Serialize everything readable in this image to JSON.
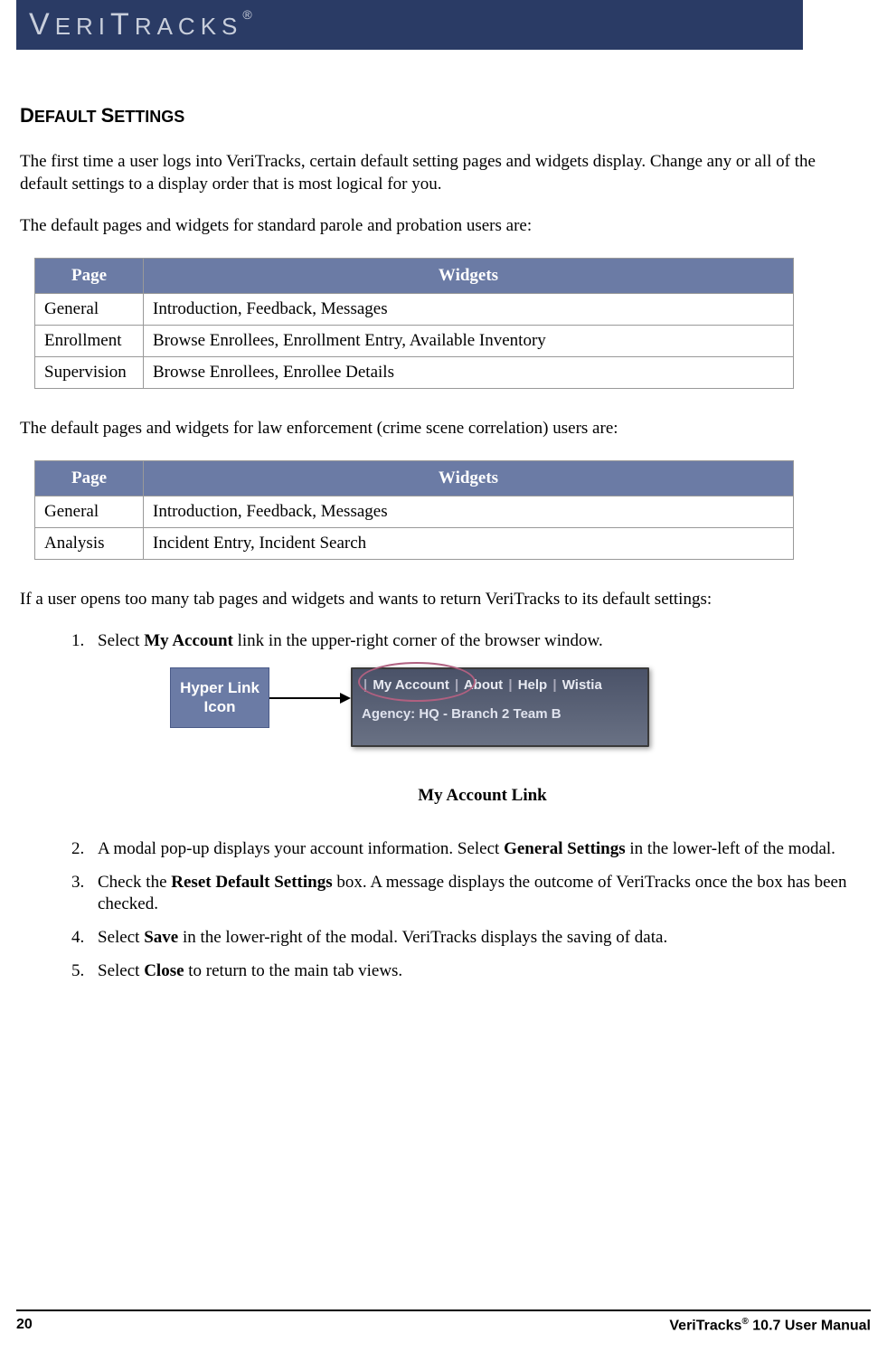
{
  "header": {
    "brand": "VERITRACKS",
    "reg": "®"
  },
  "title": {
    "big1": "D",
    "rest1": "EFAULT ",
    "big2": "S",
    "rest2": "ETTINGS"
  },
  "intro": "The first time a user logs into VeriTracks, certain default setting pages and widgets display. Change any or all of the default settings to a display order that is most logical for you.",
  "table1_intro": "The default pages and widgets for standard parole and probation users are:",
  "table_headers": {
    "page": "Page",
    "widgets": "Widgets"
  },
  "table1": [
    {
      "page": "General",
      "widgets": "Introduction, Feedback, Messages"
    },
    {
      "page": "Enrollment",
      "widgets": "Browse Enrollees, Enrollment Entry, Available Inventory"
    },
    {
      "page": "Supervision",
      "widgets": "Browse Enrollees, Enrollee Details"
    }
  ],
  "table2_intro": "The default pages and widgets for law enforcement (crime scene correlation) users are:",
  "table2": [
    {
      "page": "General",
      "widgets": "Introduction, Feedback, Messages"
    },
    {
      "page": "Analysis",
      "widgets": "Incident Entry, Incident Search"
    }
  ],
  "steps_intro": "If a user opens too many tab pages and widgets and wants to return VeriTracks to its default settings:",
  "steps": [
    {
      "pre": "Select ",
      "bold": "My Account",
      "post": " link in the upper-right corner of the browser window."
    },
    {
      "pre": "A modal pop-up displays your account information.  Select ",
      "bold": "General Settings",
      "post": " in the lower-left of the modal."
    },
    {
      "pre": "Check the ",
      "bold": "Reset Default Settings",
      "post": " box. A message displays the outcome of VeriTracks once the box has been checked."
    },
    {
      "pre": "Select ",
      "bold": "Save",
      "post": " in the lower-right of the modal. VeriTracks displays the saving of data."
    },
    {
      "pre": "Select ",
      "bold": "Close",
      "post": " to return to the main tab views."
    }
  ],
  "diagram": {
    "callout": "Hyper Link Icon",
    "top_links": {
      "a": "My Account",
      "b": "About",
      "c": "Help",
      "d": "Wistia"
    },
    "subline": "Agency: HQ - Branch 2 Team B",
    "sep": "|"
  },
  "caption": "My Account Link",
  "footer": {
    "page": "20",
    "title_pre": "VeriTracks",
    "reg": "®",
    "title_post": " 10.7 User Manual"
  }
}
